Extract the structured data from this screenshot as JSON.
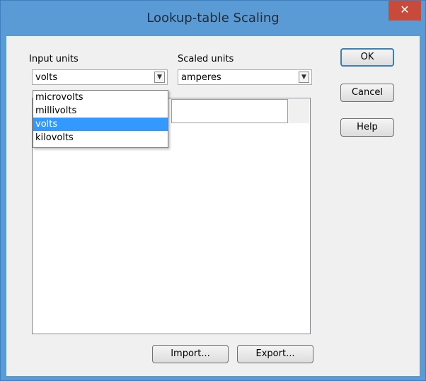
{
  "window": {
    "title": "Lookup-table Scaling",
    "close_label": "✕"
  },
  "input_units": {
    "label": "Input units",
    "selected": "volts",
    "options": [
      "microvolts",
      "millivolts",
      "volts",
      "kilovolts"
    ],
    "highlighted_index": 2
  },
  "scaled_units": {
    "label": "Scaled units",
    "selected": "amperes"
  },
  "buttons": {
    "ok": "OK",
    "cancel": "Cancel",
    "help": "Help",
    "import": "Import...",
    "export": "Export..."
  },
  "colors": {
    "titlebar": "#5a9bd6",
    "selection": "#3399ff",
    "close": "#c74a3b"
  }
}
